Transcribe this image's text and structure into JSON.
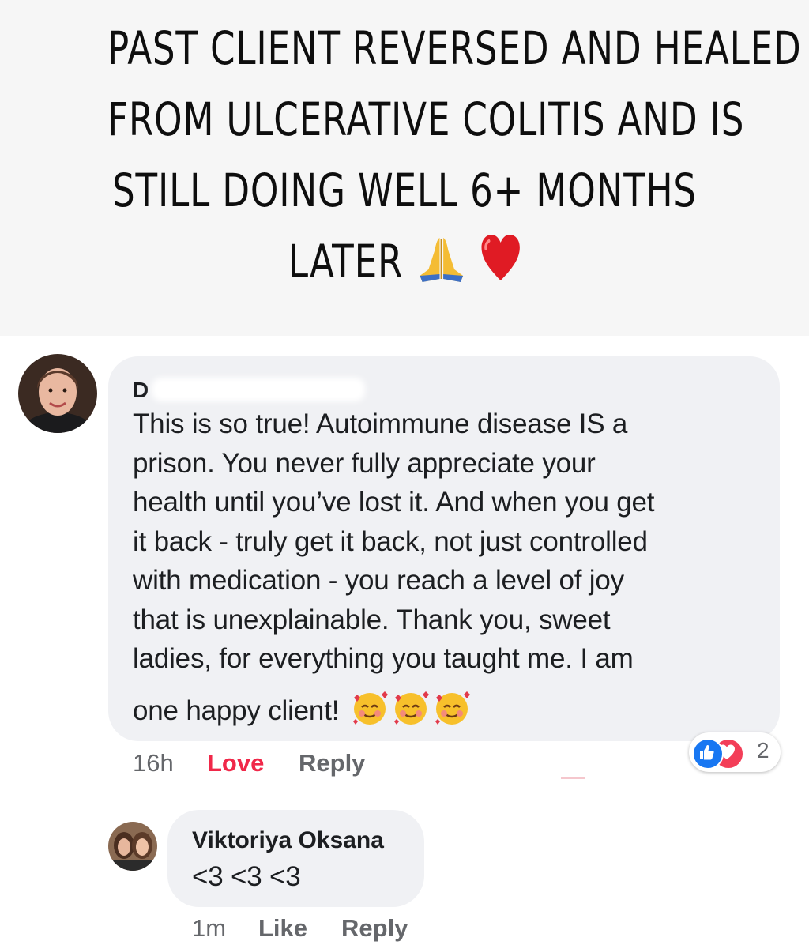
{
  "headline": {
    "lines": [
      "PAST CLIENT REVERSED AND HEALED",
      "FROM ULCERATIVE COLITIS AND IS",
      "STILL DOING WELL 6+ MONTHS",
      "LATER"
    ],
    "emojis": [
      "folded-hands-icon",
      "red-heart-icon"
    ]
  },
  "comment1": {
    "author": "D",
    "text_lines": [
      "This is so true! Autoimmune disease IS a",
      "prison. You never fully appreciate your",
      "health until you’ve lost it. And when you get",
      "it back - truly get it back, not just controlled",
      "with medication - you reach a level of joy",
      "that is unexplainable. Thank you, sweet",
      "ladies, for everything you taught me. I am",
      "one happy client!"
    ],
    "time": "16h",
    "love_label": "Love",
    "reply_label": "Reply",
    "reaction_count": "2"
  },
  "comment2": {
    "author": "Viktoriya Oksana",
    "text": "<3 <3 <3",
    "time": "1m",
    "like_label": "Like",
    "reply_label": "Reply"
  },
  "colors": {
    "header_bg": "#f6f6f6",
    "bubble_bg": "#f0f1f4",
    "love_red": "#f02849",
    "like_blue": "#1877f2",
    "meta_gray": "#65676b"
  }
}
